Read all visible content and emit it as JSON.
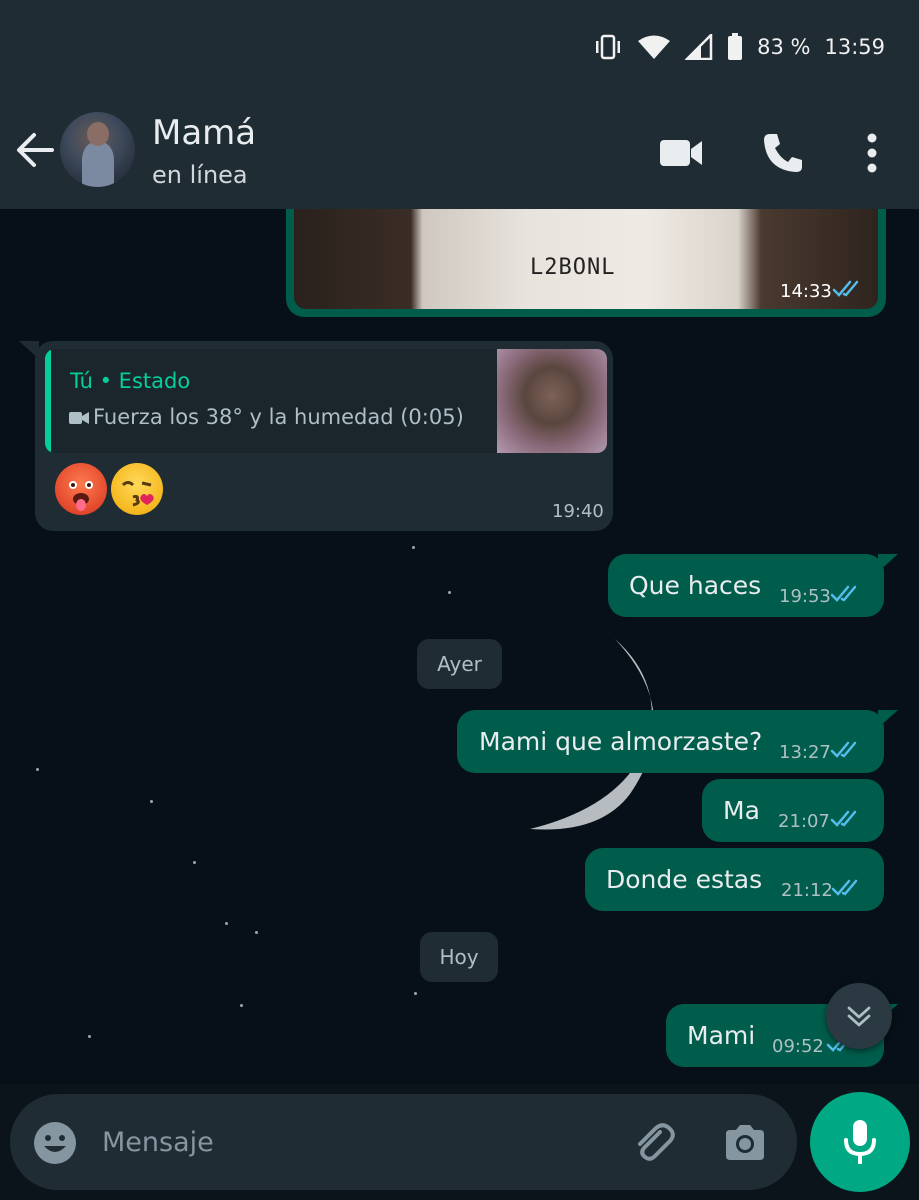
{
  "status_bar": {
    "battery": "83 %",
    "time": "13:59"
  },
  "header": {
    "contact_name": "Mamá",
    "contact_status": "en línea"
  },
  "messages": {
    "image": {
      "time": "14:33",
      "caption_code": "L2BONL"
    },
    "status_reply": {
      "author": "Tú • Estado",
      "text": "Fuerza los 38° y la humedad (0:05)",
      "time": "19:40"
    },
    "m1": {
      "text": "Que haces",
      "time": "19:53"
    },
    "date1": "Ayer",
    "m2": {
      "text": "Mami que almorzaste?",
      "time": "13:27"
    },
    "m3": {
      "text": "Ma",
      "time": "21:07"
    },
    "m4": {
      "text": "Donde estas",
      "time": "21:12"
    },
    "date2": "Hoy",
    "m5": {
      "text": "Mami",
      "time": "09:52"
    }
  },
  "input": {
    "placeholder": "Mensaje"
  },
  "colors": {
    "outgoing_bubble": "#005c4b",
    "incoming_bubble": "#1f2c34",
    "header": "#1f2c34",
    "accent": "#00a884",
    "read_ticks": "#53bdeb"
  }
}
